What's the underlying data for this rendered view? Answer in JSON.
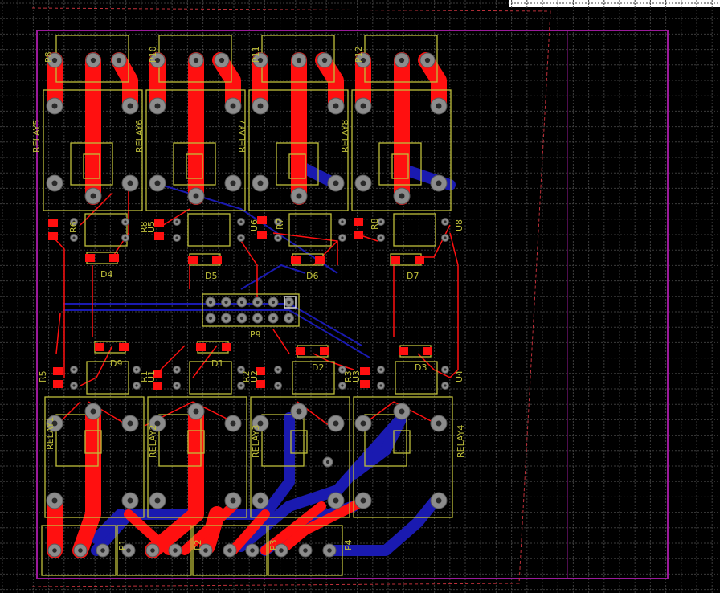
{
  "colors": {
    "background": "#000000",
    "grid": "#3c3c3c",
    "board_outline": "#9a1a9a",
    "keepout": "#c0303a",
    "top_copper": "#ff1010",
    "bottom_copper": "#1a1ab0",
    "silkscreen": "#bfbf3a",
    "pad": "#8c8c8c"
  },
  "relays": {
    "top": [
      "RELAY5",
      "RELAY6",
      "RELAY7",
      "RELAY8"
    ],
    "bottom": [
      "RELAY1",
      "RELAY2",
      "RELAY3",
      "RELAY4"
    ]
  },
  "connectors": {
    "top": [
      "P8",
      "P10",
      "P11",
      "P12"
    ],
    "bottom": [
      "P1",
      "P2",
      "P3",
      "P4"
    ],
    "header": "P9"
  },
  "diodes": {
    "top": [
      "D4",
      "D5",
      "D6",
      "D7"
    ],
    "bottom": [
      "D9",
      "D1",
      "D2",
      "D3"
    ]
  },
  "resistors": {
    "top": [
      "R6",
      "R8",
      "R7",
      "R8"
    ],
    "bottom": [
      "R5",
      "R1",
      "R2",
      "R3"
    ]
  },
  "optocouplers": {
    "top": [
      "U5",
      "U6",
      "U8"
    ],
    "bottom": [
      "U1",
      "U2",
      "U3",
      "U4"
    ]
  }
}
